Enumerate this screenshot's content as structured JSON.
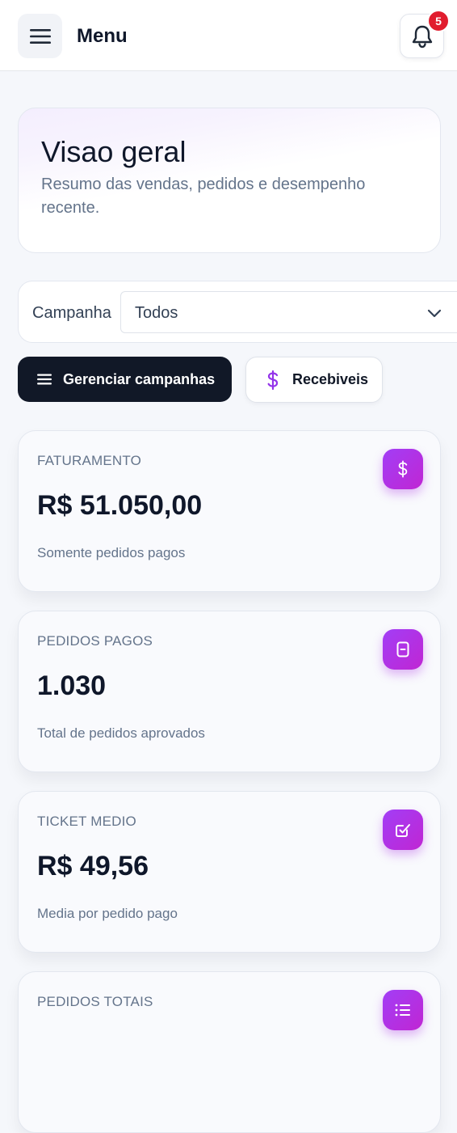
{
  "header": {
    "menu_label": "Menu",
    "notification_count": "5"
  },
  "overview": {
    "title": "Visao geral",
    "subtitle": "Resumo das vendas, pedidos e desempenho recente."
  },
  "filter": {
    "label": "Campanha",
    "selected": "Todos"
  },
  "actions": {
    "manage_label": "Gerenciar campanhas",
    "receivables_label": "Recebiveis"
  },
  "stats": [
    {
      "label": "FATURAMENTO",
      "value": "R$ 51.050,00",
      "note": "Somente pedidos pagos",
      "icon": "dollar-icon"
    },
    {
      "label": "PEDIDOS PAGOS",
      "value": "1.030",
      "note": "Total de pedidos aprovados",
      "icon": "receipt-icon"
    },
    {
      "label": "TICKET MEDIO",
      "value": "R$ 49,56",
      "note": "Media por pedido pago",
      "icon": "check-square-icon"
    },
    {
      "label": "PEDIDOS TOTAIS",
      "value": "",
      "note": "",
      "icon": "list-icon"
    }
  ],
  "colors": {
    "accent_gradient_start": "#a23ef6",
    "accent_gradient_end": "#c026d3",
    "dark_button": "#111827",
    "badge": "#e11d2e"
  }
}
